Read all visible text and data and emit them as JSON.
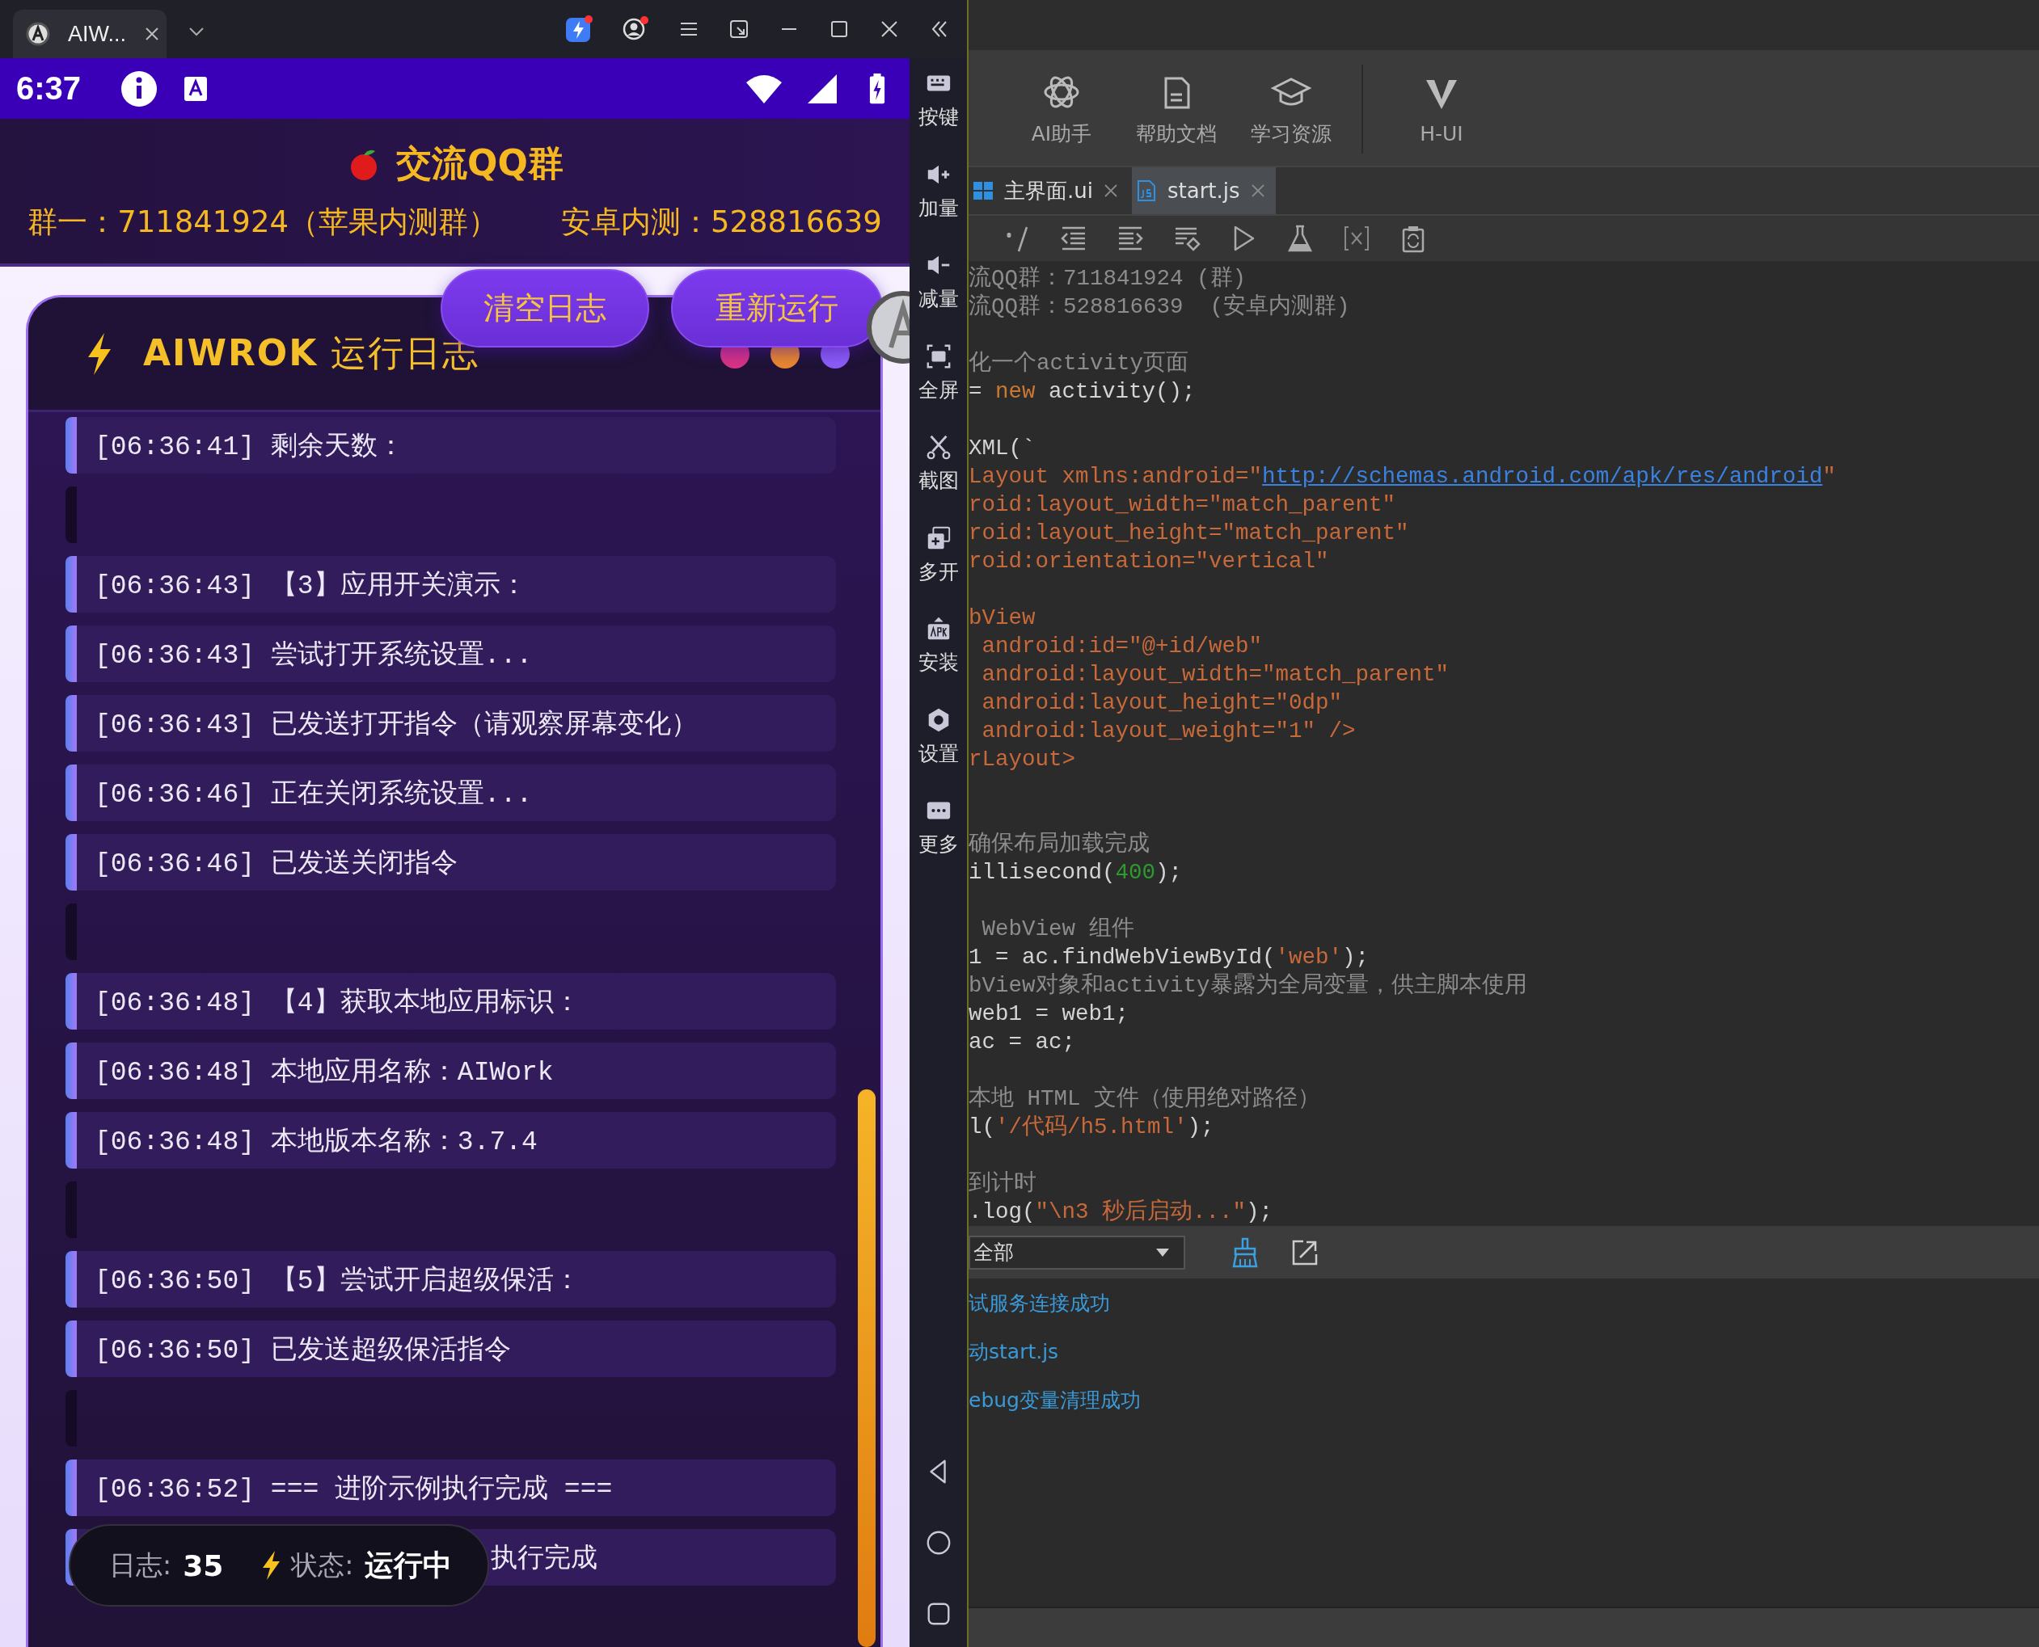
{
  "emulator": {
    "tab_title": "AIW...",
    "status_time": "6:37",
    "side_tools": [
      {
        "label": "按键",
        "kind": "keys"
      },
      {
        "label": "加量",
        "kind": "vol_up"
      },
      {
        "label": "减量",
        "kind": "vol_down"
      },
      {
        "label": "全屏",
        "kind": "fullscreen"
      },
      {
        "label": "截图",
        "kind": "screenshot"
      },
      {
        "label": "多开",
        "kind": "multi"
      },
      {
        "label": "安装",
        "kind": "install"
      },
      {
        "label": "设置",
        "kind": "settings"
      },
      {
        "label": "更多",
        "kind": "more"
      }
    ]
  },
  "app": {
    "title": "交流QQ群",
    "group_line_1": "群一：711841924（苹果内测群）",
    "group_line_2": "安卓内测：528816639",
    "buttons": [
      "清空日志",
      "重新运行"
    ],
    "log_title": "**AIWROK** 运行日志",
    "dots": [
      {
        "color": "#d63384"
      },
      {
        "color": "#e8872e"
      },
      {
        "color": "#8b5cf6"
      }
    ],
    "log": [
      {
        "kind": "entry",
        "text": "[06:36:41] 剩余天数："
      },
      {
        "kind": "blank"
      },
      {
        "kind": "entry",
        "text": "[06:36:43] 【3】应用开关演示："
      },
      {
        "kind": "entry",
        "text": "[06:36:43] 尝试打开系统设置..."
      },
      {
        "kind": "entry",
        "text": "[06:36:43] 已发送打开指令（请观察屏幕变化）"
      },
      {
        "kind": "entry",
        "text": "[06:36:46] 正在关闭系统设置..."
      },
      {
        "kind": "entry",
        "text": "[06:36:46] 已发送关闭指令"
      },
      {
        "kind": "blank"
      },
      {
        "kind": "entry",
        "text": "[06:36:48] 【4】获取本地应用标识："
      },
      {
        "kind": "entry",
        "text": "[06:36:48] 本地应用名称：AIWork"
      },
      {
        "kind": "entry",
        "text": "[06:36:48] 本地版本名称：3.7.4"
      },
      {
        "kind": "blank"
      },
      {
        "kind": "entry",
        "text": "[06:36:50] 【5】尝试开启超级保活："
      },
      {
        "kind": "entry",
        "text": "[06:36:50] 已发送超级保活指令"
      },
      {
        "kind": "blank"
      },
      {
        "kind": "entry",
        "text": "[06:36:52] === 进阶示例执行完成 ==="
      },
      {
        "kind": "covered",
        "text": "执行完成"
      }
    ],
    "status": {
      "log_label": "日志:",
      "log_count": "35",
      "state_label": "状态:",
      "state": "运行中"
    }
  },
  "ide": {
    "tools": [
      {
        "label": "AI助手",
        "kind": "ai"
      },
      {
        "label": "帮助文档",
        "kind": "docs"
      },
      {
        "label": "学习资源",
        "kind": "learn"
      },
      {
        "label": "H-UI",
        "kind": "hui"
      }
    ],
    "tabs": [
      {
        "label": "主界面.ui",
        "kind": "ui",
        "selected": false
      },
      {
        "label": "start.js",
        "kind": "js",
        "selected": true
      }
    ],
    "code": [
      {
        "kind": "code",
        "segments": [
          {
            "text": "流QQ群：711841924 (群)",
            "kind": "comment"
          }
        ]
      },
      {
        "kind": "code",
        "segments": [
          {
            "text": "流QQ群：528816639  (安卓内测群)",
            "kind": "comment"
          }
        ]
      },
      {
        "kind": "blank"
      },
      {
        "kind": "code",
        "segments": [
          {
            "text": "化一个activity页面",
            "kind": "comment"
          }
        ]
      },
      {
        "kind": "code",
        "segments": [
          {
            "text": "= ",
            "kind": "plain"
          },
          {
            "text": "new",
            "kind": "keyword"
          },
          {
            "text": " activity();",
            "kind": "plain"
          }
        ]
      },
      {
        "kind": "blank"
      },
      {
        "kind": "code",
        "segments": [
          {
            "text": "XML(`",
            "kind": "plain"
          }
        ]
      },
      {
        "kind": "code",
        "segments": [
          {
            "text": "Layout xmlns:android=\"",
            "kind": "tag"
          },
          {
            "text": "http://schemas.android.com/apk/res/android",
            "kind": "link"
          },
          {
            "text": "\"",
            "kind": "tag"
          }
        ]
      },
      {
        "kind": "code",
        "segments": [
          {
            "text": "roid:layout_width=\"match_parent\"",
            "kind": "tag"
          }
        ]
      },
      {
        "kind": "code",
        "segments": [
          {
            "text": "roid:layout_height=\"match_parent\"",
            "kind": "tag"
          }
        ]
      },
      {
        "kind": "code",
        "segments": [
          {
            "text": "roid:orientation=\"vertical\"",
            "kind": "tag"
          }
        ]
      },
      {
        "kind": "blank"
      },
      {
        "kind": "code",
        "segments": [
          {
            "text": "bView",
            "kind": "tag"
          }
        ]
      },
      {
        "kind": "code",
        "segments": [
          {
            "text": " android:id=\"@+id/web\"",
            "kind": "tag"
          }
        ]
      },
      {
        "kind": "code",
        "segments": [
          {
            "text": " android:layout_width=\"match_parent\"",
            "kind": "tag"
          }
        ]
      },
      {
        "kind": "code",
        "segments": [
          {
            "text": " android:layout_height=\"0dp\"",
            "kind": "tag"
          }
        ]
      },
      {
        "kind": "code",
        "segments": [
          {
            "text": " android:layout_weight=\"1\" />",
            "kind": "tag"
          }
        ]
      },
      {
        "kind": "code",
        "segments": [
          {
            "text": "rLayout>",
            "kind": "tag"
          }
        ]
      },
      {
        "kind": "blank"
      },
      {
        "kind": "blank"
      },
      {
        "kind": "code",
        "segments": [
          {
            "text": "确保布局加载完成",
            "kind": "comment"
          }
        ]
      },
      {
        "kind": "code",
        "segments": [
          {
            "text": "illisecond(",
            "kind": "plain"
          },
          {
            "text": "400",
            "kind": "number"
          },
          {
            "text": ");",
            "kind": "plain"
          }
        ]
      },
      {
        "kind": "blank"
      },
      {
        "kind": "code",
        "segments": [
          {
            "text": " WebView 组件",
            "kind": "comment"
          }
        ]
      },
      {
        "kind": "code",
        "segments": [
          {
            "text": "1 = ac.findWebViewById(",
            "kind": "plain"
          },
          {
            "text": "'web'",
            "kind": "string"
          },
          {
            "text": ");",
            "kind": "plain"
          }
        ]
      },
      {
        "kind": "code",
        "segments": [
          {
            "text": "bView对象和activity暴露为全局变量，供主脚本使用",
            "kind": "comment"
          }
        ]
      },
      {
        "kind": "code",
        "segments": [
          {
            "text": "web1 = web1;",
            "kind": "plain"
          }
        ]
      },
      {
        "kind": "code",
        "segments": [
          {
            "text": "ac = ac;",
            "kind": "plain"
          }
        ]
      },
      {
        "kind": "blank"
      },
      {
        "kind": "code",
        "segments": [
          {
            "text": "本地 HTML 文件（使用绝对路径）",
            "kind": "comment"
          }
        ]
      },
      {
        "kind": "code",
        "segments": [
          {
            "text": "l(",
            "kind": "plain"
          },
          {
            "text": "'/代码/h5.html'",
            "kind": "string"
          },
          {
            "text": ");",
            "kind": "plain"
          }
        ]
      },
      {
        "kind": "blank"
      },
      {
        "kind": "code",
        "segments": [
          {
            "text": "到计时",
            "kind": "comment"
          }
        ]
      },
      {
        "kind": "code",
        "segments": [
          {
            "text": ".log(",
            "kind": "plain"
          },
          {
            "text": "\"\\n3 秒后启动...\"",
            "kind": "string"
          },
          {
            "text": ");",
            "kind": "plain"
          }
        ]
      }
    ],
    "console": {
      "filter": "全部",
      "lines": [
        "试服务连接成功",
        "动start.js",
        "ebug变量清理成功"
      ]
    }
  }
}
